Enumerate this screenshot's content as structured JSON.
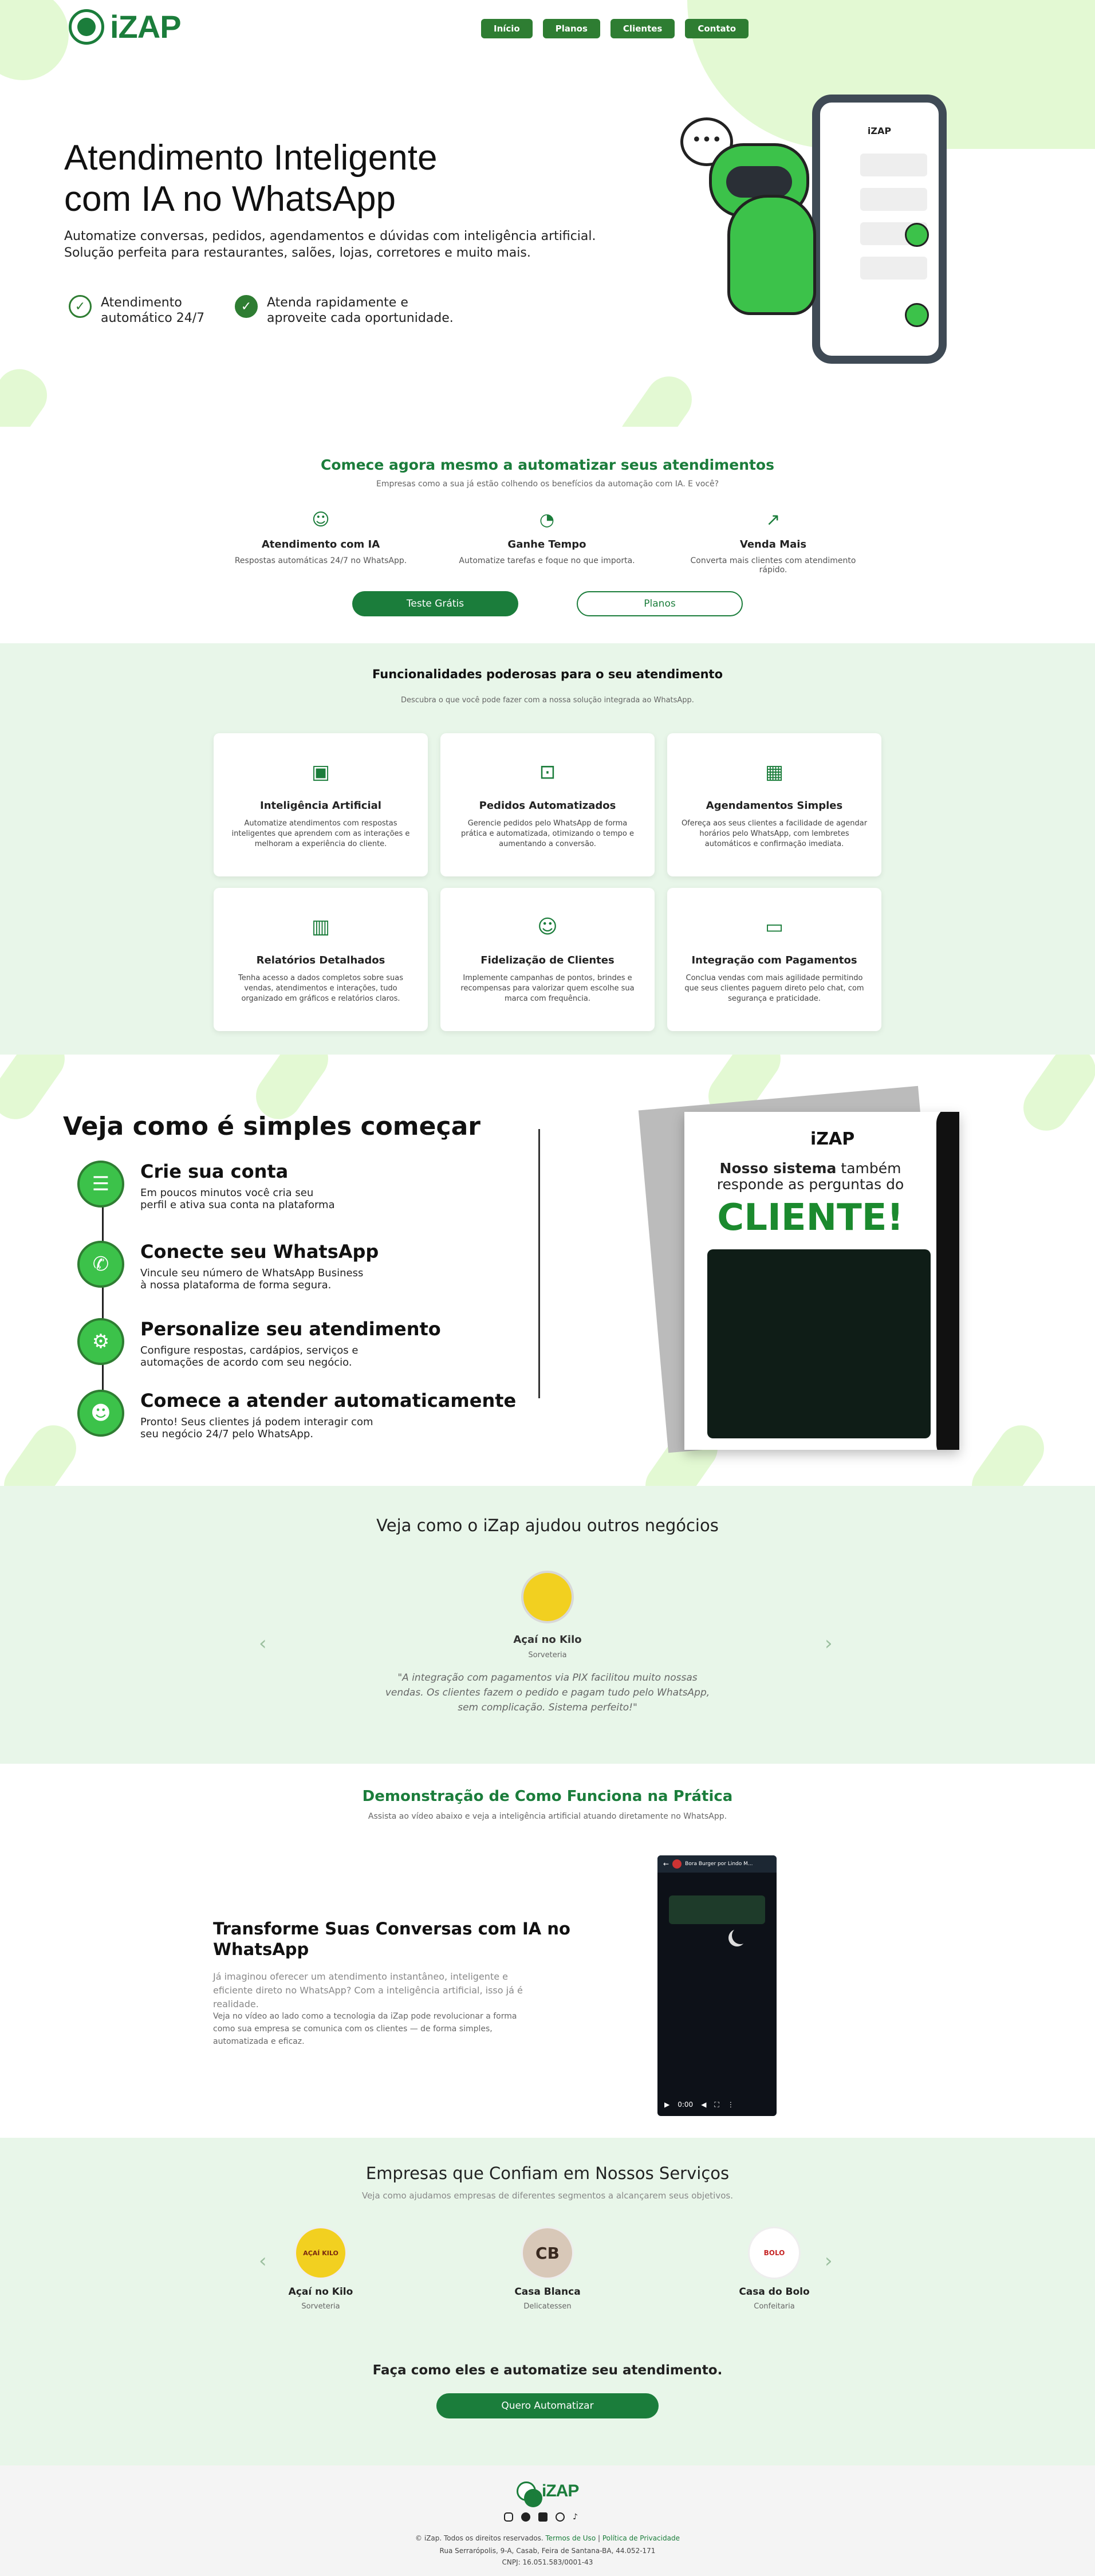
{
  "brand": {
    "name": "iZAP"
  },
  "nav": [
    "Início",
    "Planos",
    "Clientes",
    "Contato"
  ],
  "hero": {
    "title_line1": "Atendimento Inteligente",
    "title_line2": "com IA no WhatsApp",
    "subtitle_line1": "Automatize conversas, pedidos, agendamentos e dúvidas com inteligência artificial.",
    "subtitle_line2": "Solução perfeita para restaurantes, salões, lojas, corretores e muito mais.",
    "features": [
      {
        "line1": "Atendimento",
        "line2": "automático 24/7",
        "icon": "shield-check-icon"
      },
      {
        "line1": "Atenda rapidamente e",
        "line2": "aproveite cada oportunidade.",
        "icon": "badge-check-icon"
      }
    ],
    "illustration": {
      "speech_bubble": "•••",
      "phone_header": "iZAP"
    }
  },
  "start": {
    "title": "Comece agora mesmo a automatizar seus atendimentos",
    "subtitle": "Empresas como a sua já estão colhendo os benefícios da automação com IA. E você?",
    "benefits": [
      {
        "title": "Atendimento com IA",
        "desc": "Respostas automáticas 24/7 no WhatsApp.",
        "icon": "robot-icon"
      },
      {
        "title": "Ganhe Tempo",
        "desc": "Automatize tarefas e foque no que importa.",
        "icon": "speedometer-icon"
      },
      {
        "title": "Venda Mais",
        "desc": "Converta mais clientes com atendimento rápido.",
        "icon": "chart-up-icon"
      }
    ],
    "btn_trial": "Teste Grátis",
    "btn_plans": "Planos"
  },
  "features": {
    "title": "Funcionalidades poderosas para o seu atendimento",
    "subtitle": "Descubra o que você pode fazer com a nossa solução integrada ao WhatsApp.",
    "cards": [
      {
        "title": "Inteligência Artificial",
        "desc": "Automatize atendimentos com respostas inteligentes que aprendem com as interações e melhoram a experiência do cliente.",
        "icon": "cpu-icon"
      },
      {
        "title": "Pedidos Automatizados",
        "desc": "Gerencie pedidos pelo WhatsApp de forma prática e automatizada, otimizando o tempo e aumentando a conversão.",
        "icon": "bag-check-icon"
      },
      {
        "title": "Agendamentos Simples",
        "desc": "Ofereça aos seus clientes a facilidade de agendar horários pelo WhatsApp, com lembretes automáticos e confirmação imediata.",
        "icon": "calendar-check-icon"
      },
      {
        "title": "Relatórios Detalhados",
        "desc": "Tenha acesso a dados completos sobre suas vendas, atendimentos e interações, tudo organizado em gráficos e relatórios claros.",
        "icon": "bar-chart-icon"
      },
      {
        "title": "Fidelização de Clientes",
        "desc": "Implemente campanhas de pontos, brindes e recompensas para valorizar quem escolhe sua marca com frequência.",
        "icon": "smile-icon"
      },
      {
        "title": "Integração com Pagamentos",
        "desc": "Conclua vendas com mais agilidade permitindo que seus clientes paguem direto pelo chat, com segurança e praticidade.",
        "icon": "credit-card-icon"
      }
    ]
  },
  "steps": {
    "title": "Veja como é simples começar",
    "items": [
      {
        "title": "Crie sua conta",
        "line1": "Em poucos minutos você cria seu",
        "line2": "perfil e ativa sua conta na plataforma",
        "line3": "",
        "icon": "form-icon"
      },
      {
        "title": "Conecte seu WhatsApp",
        "line1": "Vincule seu número de WhatsApp Business",
        "line2": "à nossa plataforma de forma segura.",
        "line3": "",
        "icon": "whatsapp-icon"
      },
      {
        "title": "Personalize seu atendimento",
        "line1": "Configure respostas, cardápios, serviços e",
        "line2": "automações de acordo com seu negócio.",
        "line3": "",
        "icon": "gear-icon"
      },
      {
        "title": "Comece a atender automaticamente",
        "line1": "Pronto! Seus clientes já podem interagir com",
        "line2": "seu negócio 24/7 pelo WhatsApp.",
        "line3": "",
        "icon": "bot-chat-icon"
      }
    ],
    "flyer": {
      "brand": "iZAP",
      "headline_bold": "Nosso sistema",
      "headline_rest": "também",
      "headline_line2": "responde as perguntas do",
      "big": "CLIENTE!"
    }
  },
  "testimonials": {
    "title": "Veja como o iZap ajudou outros negócios",
    "name": "Açaí no Kilo",
    "category": "Sorveteria",
    "quote": "\"A integração com pagamentos via PIX facilitou muito nossas vendas. Os clientes fazem o pedido e pagam tudo pelo WhatsApp, sem complicação. Sistema perfeito!\"",
    "prev": "‹",
    "next": "›"
  },
  "demo": {
    "title": "Demonstração de Como Funciona na Prática",
    "subtitle": "Assista ao vídeo abaixo e veja a inteligência artificial atuando diretamente no WhatsApp.",
    "heading_line1": "Transforme Suas Conversas com IA no",
    "heading_line2": "WhatsApp",
    "p1": "Já imaginou oferecer um atendimento instantâneo, inteligente e eficiente direto no WhatsApp? Com a inteligência artificial, isso já é realidade.",
    "p2": "Veja no vídeo ao lado como a tecnologia da iZap pode revolucionar a forma como sua empresa se comunica com os clientes — de forma simples, automatizada e eficaz.",
    "video_time": "0:00",
    "video_chat_name": "Bora Burger por Lindo M..."
  },
  "clients": {
    "title": "Empresas que Confiam em Nossos Serviços",
    "subtitle": "Veja como ajudamos empresas de diferentes segmentos a alcançarem seus objetivos.",
    "items": [
      {
        "name": "Açaí no Kilo",
        "category": "Sorveteria",
        "logo": "AÇAÍ KILO"
      },
      {
        "name": "Casa Blanca",
        "category": "Delicatessen",
        "logo": "CB"
      },
      {
        "name": "Casa do Bolo",
        "category": "Confeitaria",
        "logo": "BOLO"
      }
    ],
    "cta_title": "Faça como eles e automatize seu atendimento.",
    "cta_button": "Quero Automatizar",
    "prev": "‹",
    "next": "›"
  },
  "footer": {
    "copyright": "© iZap. Todos os direitos reservados.",
    "terms": "Termos de Uso",
    "sep": "|",
    "privacy": "Política de Privacidade",
    "address": "Rua Serrarópolis, 9-A, Casab, Feira de Santana-BA, 44.052-171",
    "cnpj": "CNPJ: 16.051.583/0001-43",
    "social": [
      "instagram-icon",
      "facebook-icon",
      "linkedin-icon",
      "whatsapp-icon",
      "tiktok-icon"
    ]
  },
  "colors": {
    "green": "#1b7d3b",
    "light_green": "#e3f9d3",
    "section_bg": "#e8f6e9",
    "bright_green": "#3cc24a"
  }
}
